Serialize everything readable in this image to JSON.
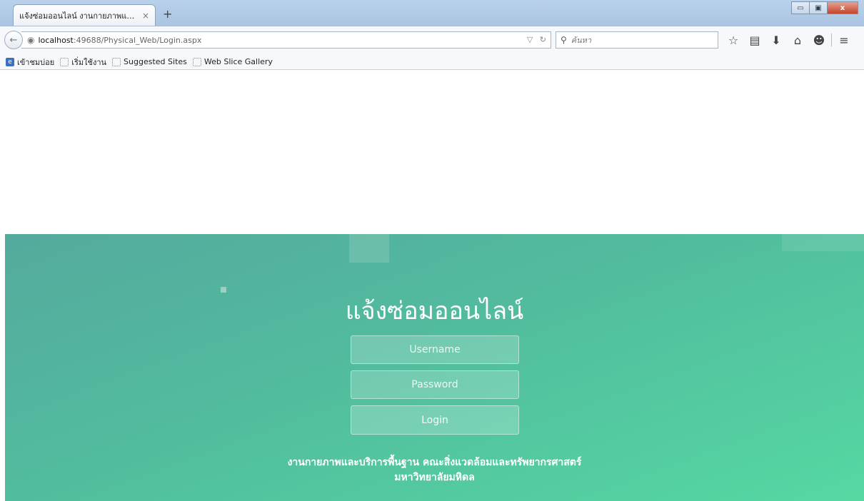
{
  "browser": {
    "tab_title": "แจ้งซ่อมออนไลน์ งานกายภาพและ...",
    "tab_close": "×",
    "new_tab": "+",
    "window_controls": {
      "minimize": "▭",
      "restore": "▣",
      "close": "x"
    },
    "url_host": "localhost",
    "url_path": ":49688/Physical_Web/Login.aspx",
    "search_placeholder": "ค้นหา",
    "bookmarks": [
      "เข้าชมบ่อย",
      "เริ่มใช้งาน",
      "Suggested Sites",
      "Web Slice Gallery"
    ]
  },
  "page": {
    "heading": "แจ้งซ่อมออนไลน์",
    "username_placeholder": "Username",
    "password_placeholder": "Password",
    "login_label": "Login",
    "footer_line1": "งานกายภาพและบริการพื้นฐาน คณะสิ่งแวดล้อมและทรัพยากรศาสตร์",
    "footer_line2": "มหาวิทยาลัยมหิดล"
  },
  "colors": {
    "gradient_start": "#54aa9d",
    "gradient_end": "#55d8a2",
    "text": "#ffffff"
  }
}
